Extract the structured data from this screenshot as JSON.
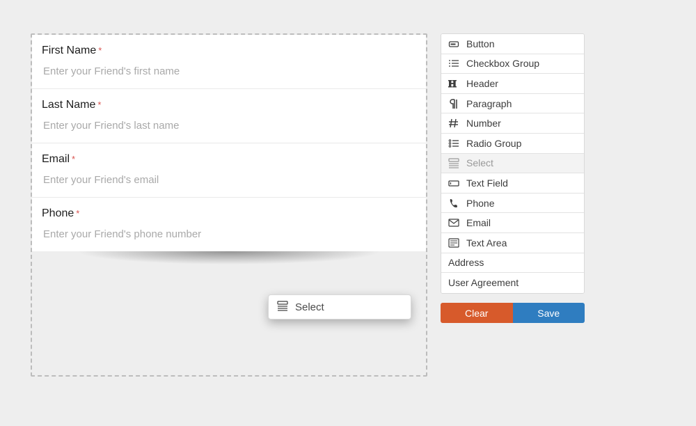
{
  "form": {
    "fields": [
      {
        "label": "First Name",
        "required": true,
        "placeholder": "Enter your Friend's first name"
      },
      {
        "label": "Last Name",
        "required": true,
        "placeholder": "Enter your Friend's last name"
      },
      {
        "label": "Email",
        "required": true,
        "placeholder": "Enter your Friend's email"
      },
      {
        "label": "Phone",
        "required": true,
        "placeholder": "Enter your Friend's phone number"
      }
    ]
  },
  "drag_chip": {
    "icon": "select-icon",
    "label": "Select"
  },
  "palette": {
    "items": [
      {
        "icon": "button-icon",
        "label": "Button"
      },
      {
        "icon": "checkbox-icon",
        "label": "Checkbox Group"
      },
      {
        "icon": "header-icon",
        "label": "Header"
      },
      {
        "icon": "paragraph-icon",
        "label": "Paragraph"
      },
      {
        "icon": "number-icon",
        "label": "Number"
      },
      {
        "icon": "radio-icon",
        "label": "Radio Group"
      },
      {
        "icon": "select-icon",
        "label": "Select",
        "hover": true
      },
      {
        "icon": "textfield-icon",
        "label": "Text Field"
      },
      {
        "icon": "phone-icon",
        "label": "Phone"
      },
      {
        "icon": "email-icon",
        "label": "Email"
      },
      {
        "icon": "textarea-icon",
        "label": "Text Area"
      },
      {
        "icon": null,
        "label": "Address"
      },
      {
        "icon": null,
        "label": "User Agreement"
      }
    ]
  },
  "buttons": {
    "clear": "Clear",
    "save": "Save"
  }
}
